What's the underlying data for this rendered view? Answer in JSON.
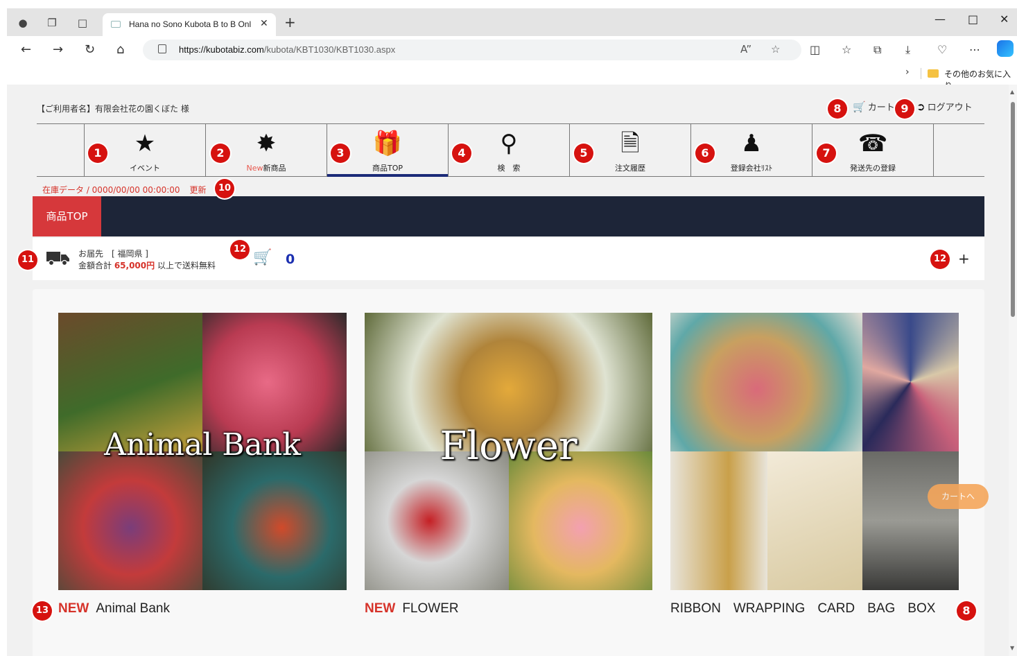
{
  "browser": {
    "tab_title": "Hana no Sono Kubota B to B Onl",
    "url_host": "https://kubotabiz.com",
    "url_path": "/kubota/KBT1030/KBT1030.aspx",
    "favorites_label": "その他のお気に入り",
    "icons": [
      "profile-icon",
      "workspaces-icon",
      "tab-actions-icon",
      "back-icon",
      "forward-icon",
      "refresh-icon",
      "home-icon",
      "read-aloud-icon",
      "favorite-star-icon",
      "split-screen-icon",
      "favorites-icon",
      "collections-icon",
      "downloads-icon",
      "browser-essentials-icon",
      "more-icon",
      "copilot-icon"
    ]
  },
  "header": {
    "user": "【ご利用者名】有限会社花の園くぼた 様",
    "cart_label": "カート",
    "logout_label": "ログアウト"
  },
  "menu": {
    "items": [
      {
        "label": "イベント",
        "icon": "event-icon"
      },
      {
        "label_new": "New",
        "label": "新商品",
        "icon": "new-badge-icon"
      },
      {
        "label": "商品TOP",
        "icon": "gift-icon"
      },
      {
        "label": "検　索",
        "icon": "search-icon"
      },
      {
        "label": "注文履歴",
        "icon": "order-history-icon"
      },
      {
        "label": "登録会社ﾘｽﾄ",
        "icon": "person-icon"
      },
      {
        "label": "発送先の登録",
        "icon": "address-book-icon"
      }
    ],
    "active_index": 2
  },
  "stock": {
    "text": "在庫データ / 0000/00/00 00:00:00",
    "update_label": "更新"
  },
  "breadcrumb": "商品TOP",
  "delivery": {
    "line1": "お届先　[ 福岡県 ]",
    "line2_prefix": "金額合計 ",
    "amount": "65,000円",
    "line2_suffix": " 以上で送料無料",
    "cart_count": "0",
    "expand_label": "+"
  },
  "products": [
    {
      "new": "NEW",
      "title": "Animal Bank",
      "overlay": "Animal Bank"
    },
    {
      "new": "NEW",
      "title": "FLOWER",
      "overlay": "Flower"
    },
    {
      "words": [
        "RIBBON",
        "WRAPPING",
        "CARD",
        "BAG",
        "BOX"
      ]
    }
  ],
  "floating_cart": "カートへ",
  "badges": {
    "b1": "1",
    "b2": "2",
    "b3": "3",
    "b4": "4",
    "b5": "5",
    "b6": "6",
    "b7": "7",
    "b8a": "8",
    "b9": "9",
    "b10": "10",
    "b11": "11",
    "b12a": "12",
    "b12b": "12",
    "b13": "13",
    "b8b": "8"
  },
  "colors": {
    "accent_red": "#d6332a",
    "banner_navy": "#1d2538",
    "active_underline": "#1b2a78",
    "badge_red": "#d6120f"
  }
}
